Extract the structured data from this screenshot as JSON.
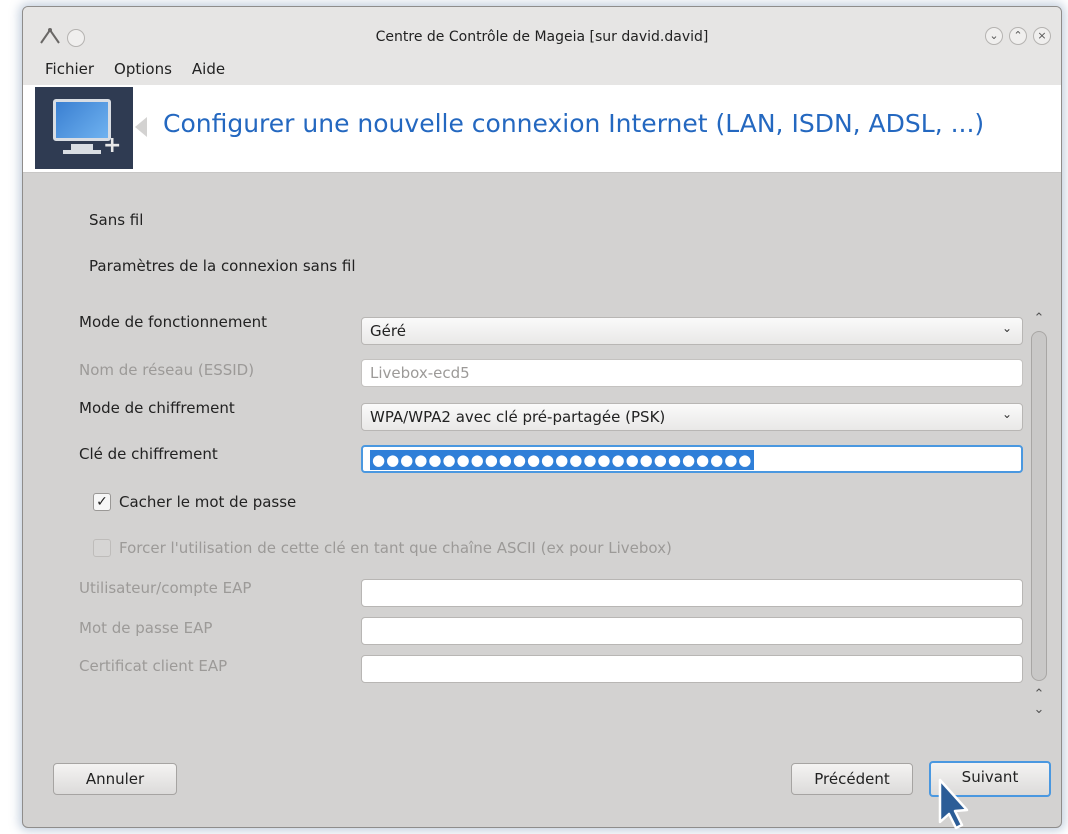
{
  "window": {
    "title": "Centre de Contrôle de Mageia  [sur david.david]",
    "title_left_icons": [
      "app-icon",
      "sticky-icon"
    ],
    "title_right_buttons": [
      "minimize-icon",
      "maximize-icon",
      "close-icon"
    ]
  },
  "menu": {
    "file": "Fichier",
    "options": "Options",
    "help": "Aide"
  },
  "banner": {
    "icon": "network-monitor-icon",
    "title": "Configurer une nouvelle connexion Internet (LAN, ISDN, ADSL, ...)"
  },
  "sections": {
    "heading": "Sans fil",
    "subheading": "Paramètres de la connexion sans fil"
  },
  "form": {
    "mode_label": "Mode de fonctionnement",
    "mode_value": "Géré",
    "essid_label": "Nom de réseau (ESSID)",
    "essid_value": "Livebox-ecd5",
    "encryption_mode_label": "Mode de chiffrement",
    "encryption_mode_value": "WPA/WPA2 avec clé pré-partagée (PSK)",
    "encryption_key_label": "Clé de chiffrement",
    "encryption_key_value": "●●●●●●●●●●●●●●●●●●●●●●●●●●●",
    "hide_password_label": "Cacher le mot de passe",
    "hide_password_checked": true,
    "force_ascii_label": "Forcer l'utilisation de cette clé en tant que chaîne ASCII (ex pour Livebox)",
    "force_ascii_checked": false,
    "eap_user_label": "Utilisateur/compte EAP",
    "eap_user_value": "",
    "eap_password_label": "Mot de passe EAP",
    "eap_password_value": "",
    "eap_cert_label": "Certificat client EAP",
    "eap_cert_value": ""
  },
  "buttons": {
    "cancel": "Annuler",
    "previous": "Précédent",
    "next": "Suivant"
  },
  "colors": {
    "banner_title": "#2468c0",
    "focus": "#4a98e0",
    "window_bg": "#d3d2d1"
  }
}
